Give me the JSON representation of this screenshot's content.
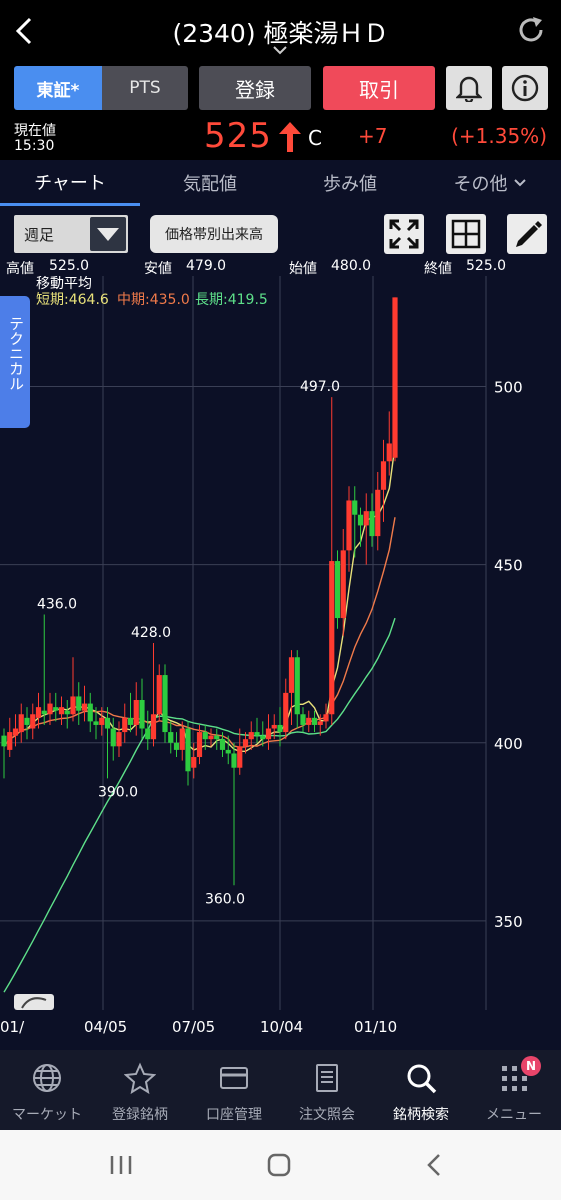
{
  "header": {
    "title": "(2340) 極楽湯ＨＤ"
  },
  "buttons": {
    "tosho": "東証*",
    "pts": "PTS",
    "register": "登録",
    "trade": "取引"
  },
  "price": {
    "label_current": "現在値",
    "time": "15:30",
    "value": "525",
    "flag": "C",
    "change": "+7",
    "change_pct": "(+1.35%)",
    "up_color": "#ff4a3a"
  },
  "tabs": [
    "チャート",
    "気配値",
    "歩み値",
    "その他"
  ],
  "toolbar": {
    "period": "週足",
    "volume_btn": "価格帯別出来高"
  },
  "ohlc": {
    "high_label": "高値",
    "high": "525.0",
    "low_label": "安値",
    "low": "479.0",
    "open_label": "始値",
    "open": "480.0",
    "close_label": "終値",
    "close": "525.0"
  },
  "legend": {
    "title": "移動平均",
    "short": "短期:464.6",
    "mid": "中期:435.0",
    "long": "長期:419.5",
    "short_color": "#e8e17a",
    "mid_color": "#f07a4a",
    "long_color": "#5ee08a"
  },
  "side_tab": "テクニカル",
  "chart_data": {
    "type": "candlestick",
    "y_ticks": [
      "500",
      "450",
      "400",
      "350"
    ],
    "ylim": [
      325,
      531
    ],
    "x_ticks": [
      "01/",
      "04/05",
      "07/05",
      "10/04",
      "01/10"
    ],
    "annotations": [
      {
        "text": "436.0",
        "value": 436
      },
      {
        "text": "428.0",
        "value": 428
      },
      {
        "text": "390.0",
        "value": 390
      },
      {
        "text": "360.0",
        "value": 360
      },
      {
        "text": "497.0",
        "value": 497
      }
    ],
    "up_color": "#ff3b30",
    "down_color": "#2ecc40"
  },
  "nav": [
    {
      "label": "マーケット",
      "icon": "globe-icon"
    },
    {
      "label": "登録銘柄",
      "icon": "star-icon"
    },
    {
      "label": "口座管理",
      "icon": "card-icon"
    },
    {
      "label": "注文照会",
      "icon": "document-icon"
    },
    {
      "label": "銘柄検索",
      "icon": "search-icon"
    },
    {
      "label": "メニュー",
      "icon": "menu-dots-icon",
      "badge": "N"
    }
  ]
}
